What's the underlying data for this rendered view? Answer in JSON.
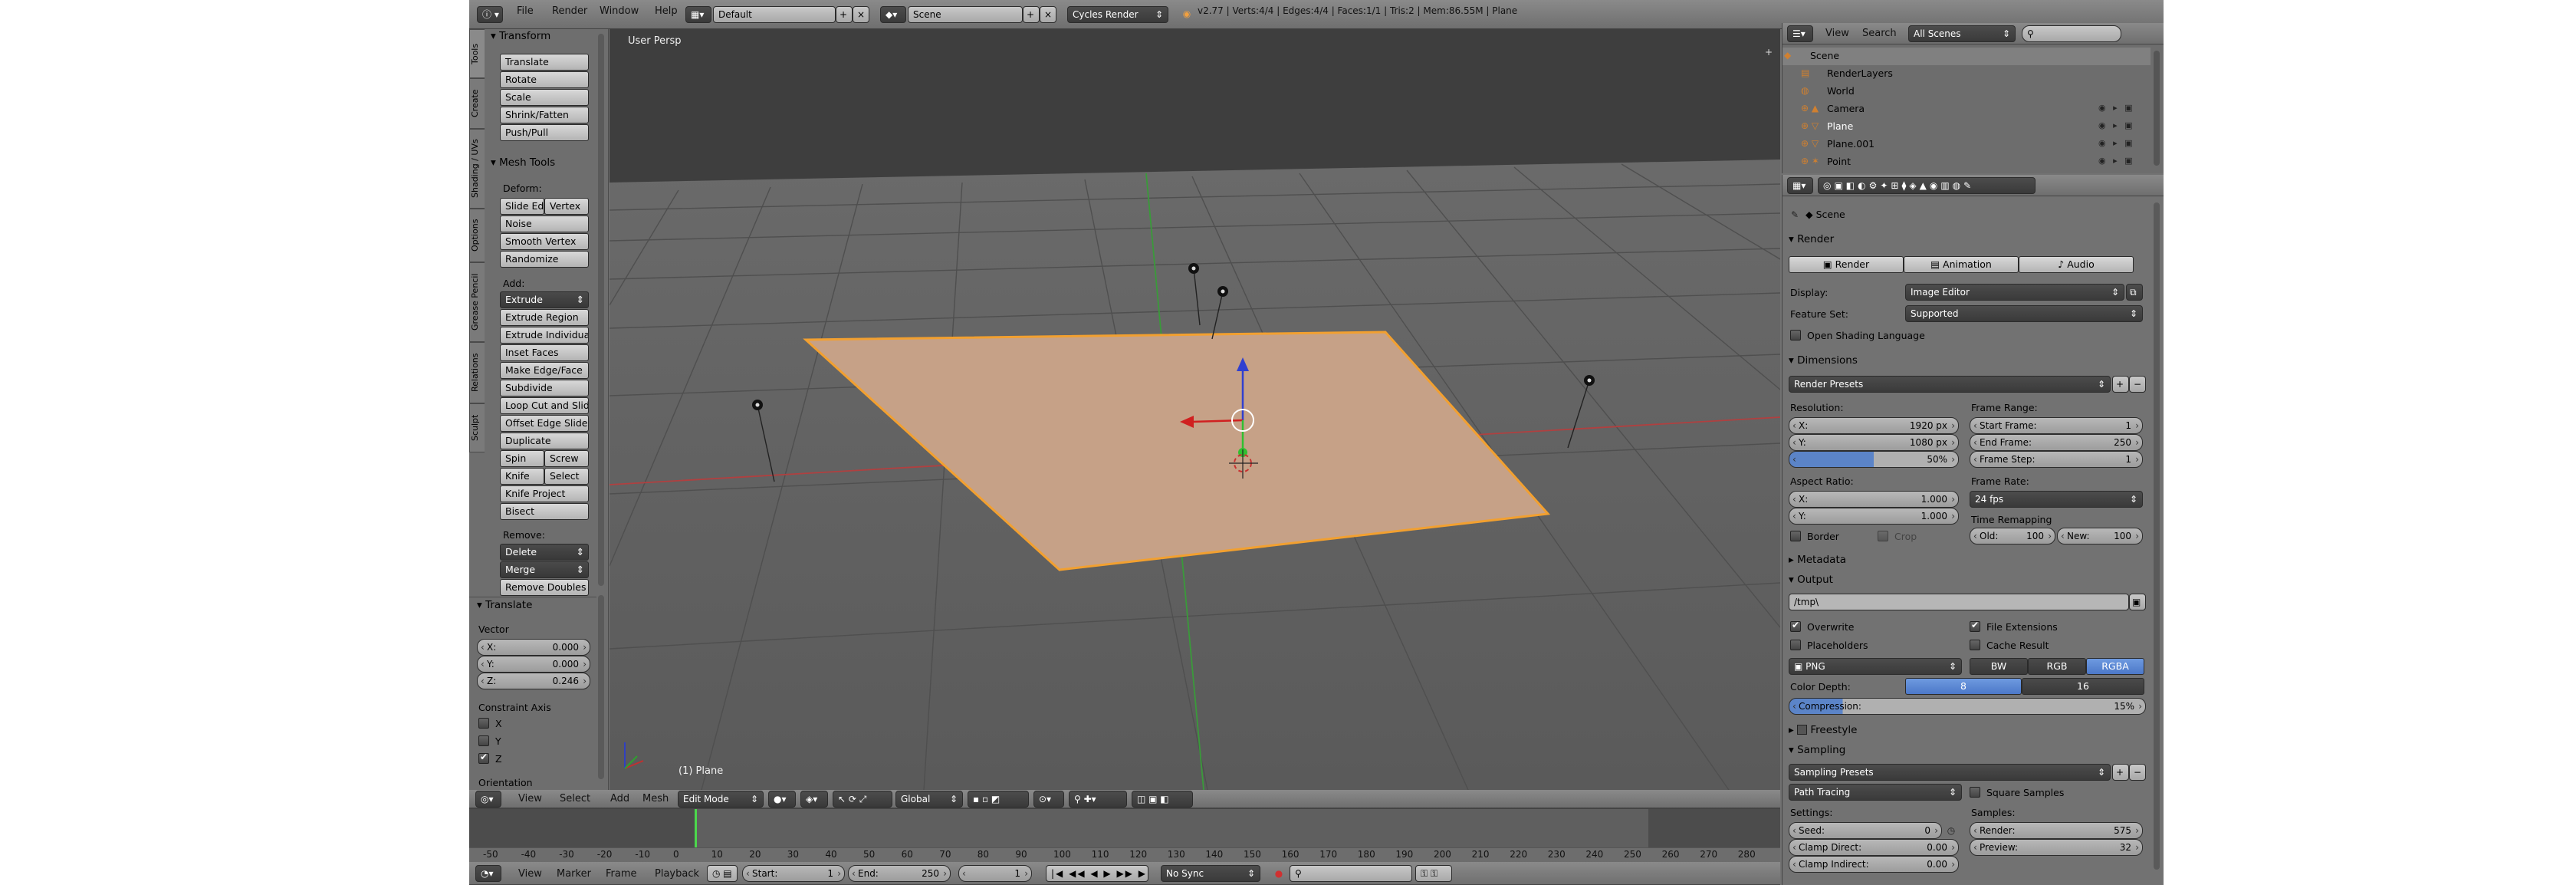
{
  "top_header": {
    "menus": [
      "File",
      "Render",
      "Window",
      "Help"
    ],
    "layout": "Default",
    "scene": "Scene",
    "engine": "Cycles Render",
    "stats": "v2.77 | Verts:4/4 | Edges:4/4 | Faces:1/1 | Tris:2 | Mem:86.55M | Plane"
  },
  "tools_tabs": [
    "Tools",
    "Create",
    "Shading / UVs",
    "Options",
    "Grease Pencil",
    "Relations",
    "Sculpt"
  ],
  "tool_shelf": {
    "transform_title": "Transform",
    "transform": [
      "Translate",
      "Rotate",
      "Scale",
      "Shrink/Fatten",
      "Push/Pull"
    ],
    "mesh_tools_title": "Mesh Tools",
    "deform_label": "Deform:",
    "slide_edge": "Slide Ed",
    "vertex": "Vertex",
    "deform": [
      "Noise",
      "Smooth Vertex",
      "Randomize"
    ],
    "add_label": "Add:",
    "extrude": "Extrude",
    "add": [
      "Extrude Region",
      "Extrude Individual",
      "Inset Faces",
      "Make Edge/Face",
      "Subdivide",
      "Loop Cut and Slide",
      "Offset Edge Slide",
      "Duplicate"
    ],
    "spin": "Spin",
    "screw": "Screw",
    "knife": "Knife",
    "select": "Select",
    "add2": [
      "Knife Project",
      "Bisect"
    ],
    "remove_label": "Remove:",
    "delete": "Delete",
    "merge": "Merge",
    "remove_doubles": "Remove Doubles"
  },
  "operator": {
    "title": "Translate",
    "vector_label": "Vector",
    "x_label": "X:",
    "x_value": "0.000",
    "y_label": "Y:",
    "y_value": "0.000",
    "z_label": "Z:",
    "z_value": "0.246",
    "constraint_label": "Constraint Axis",
    "cx": "X",
    "cy": "Y",
    "cz": "Z",
    "orientation_label": "Orientation"
  },
  "viewport": {
    "persp_label": "User Persp",
    "object_label": "(1) Plane",
    "colors": {
      "bg": "#5c5c5c",
      "plane_fill": "#c7a287",
      "plane_edge": "#f09a2a",
      "x_axis": "#b83c3c",
      "y_axis": "#3e9a3e"
    }
  },
  "viewport_header": {
    "menus": [
      "View",
      "Select",
      "Add",
      "Mesh"
    ],
    "mode": "Edit Mode",
    "orientation": "Global"
  },
  "timeline": {
    "ticks": [
      "-50",
      "-40",
      "-30",
      "-20",
      "-10",
      "0",
      "10",
      "20",
      "30",
      "40",
      "50",
      "60",
      "70",
      "80",
      "90",
      "100",
      "110",
      "120",
      "130",
      "140",
      "150",
      "160",
      "170",
      "180",
      "190",
      "200",
      "210",
      "220",
      "230",
      "240",
      "250",
      "260",
      "270",
      "280"
    ],
    "current_frame_value": 0
  },
  "timeline_header": {
    "menus": [
      "View",
      "Marker",
      "Frame",
      "Playback"
    ],
    "start_label": "Start:",
    "start_value": "1",
    "end_label": "End:",
    "end_value": "250",
    "current": "1",
    "sync": "No Sync"
  },
  "outliner": {
    "menus": [
      "View",
      "Search"
    ],
    "filter": "All Scenes",
    "items": [
      "Scene",
      "RenderLayers",
      "World",
      "Camera",
      "Plane",
      "Plane.001",
      "Point"
    ]
  },
  "properties": {
    "scene_label": "Scene",
    "render": {
      "title": "Render",
      "buttons": [
        "Render",
        "Animation",
        "Audio"
      ],
      "display_label": "Display:",
      "display_value": "Image Editor",
      "feature_label": "Feature Set:",
      "feature_value": "Supported",
      "osl_label": "Open Shading Language"
    },
    "dimensions": {
      "title": "Dimensions",
      "presets": "Render Presets",
      "resolution_label": "Resolution:",
      "res_x_label": "X:",
      "res_x": "1920 px",
      "res_y_label": "Y:",
      "res_y": "1080 px",
      "res_pct": "50%",
      "frame_range_label": "Frame Range:",
      "start_label": "Start Frame:",
      "start": "1",
      "end_label": "End Frame:",
      "end": "250",
      "step_label": "Frame Step:",
      "step": "1",
      "aspect_label": "Aspect Ratio:",
      "asp_x_label": "X:",
      "asp_x": "1.000",
      "asp_y_label": "Y:",
      "asp_y": "1.000",
      "frame_rate_label": "Frame Rate:",
      "frame_rate": "24 fps",
      "border_label": "Border",
      "crop_label": "Crop",
      "remap_label": "Time Remapping",
      "old_label": "Old:",
      "old": "100",
      "new_label": "New:",
      "new": "100"
    },
    "metadata_title": "Metadata",
    "output": {
      "title": "Output",
      "path": "/tmp\\",
      "overwrite": "Overwrite",
      "file_ext": "File Extensions",
      "placeholders": "Placeholders",
      "cache": "Cache Result",
      "format": "PNG",
      "bw": "BW",
      "rgb": "RGB",
      "rgba": "RGBA",
      "depth_label": "Color Depth:",
      "depth8": "8",
      "depth16": "16",
      "compression_label": "Compression:",
      "compression": "15%"
    },
    "freestyle_title": "Freestyle",
    "sampling": {
      "title": "Sampling",
      "presets": "Sampling Presets",
      "method": "Path Tracing",
      "square": "Square Samples",
      "settings_label": "Settings:",
      "samples_label": "Samples:",
      "seed_label": "Seed:",
      "seed": "0",
      "clamp_direct_label": "Clamp Direct:",
      "clamp_direct": "0.00",
      "clamp_indirect_label": "Clamp Indirect:",
      "clamp_indirect": "0.00",
      "render_label": "Render:",
      "render": "575",
      "preview_label": "Preview:",
      "preview": "32"
    }
  }
}
